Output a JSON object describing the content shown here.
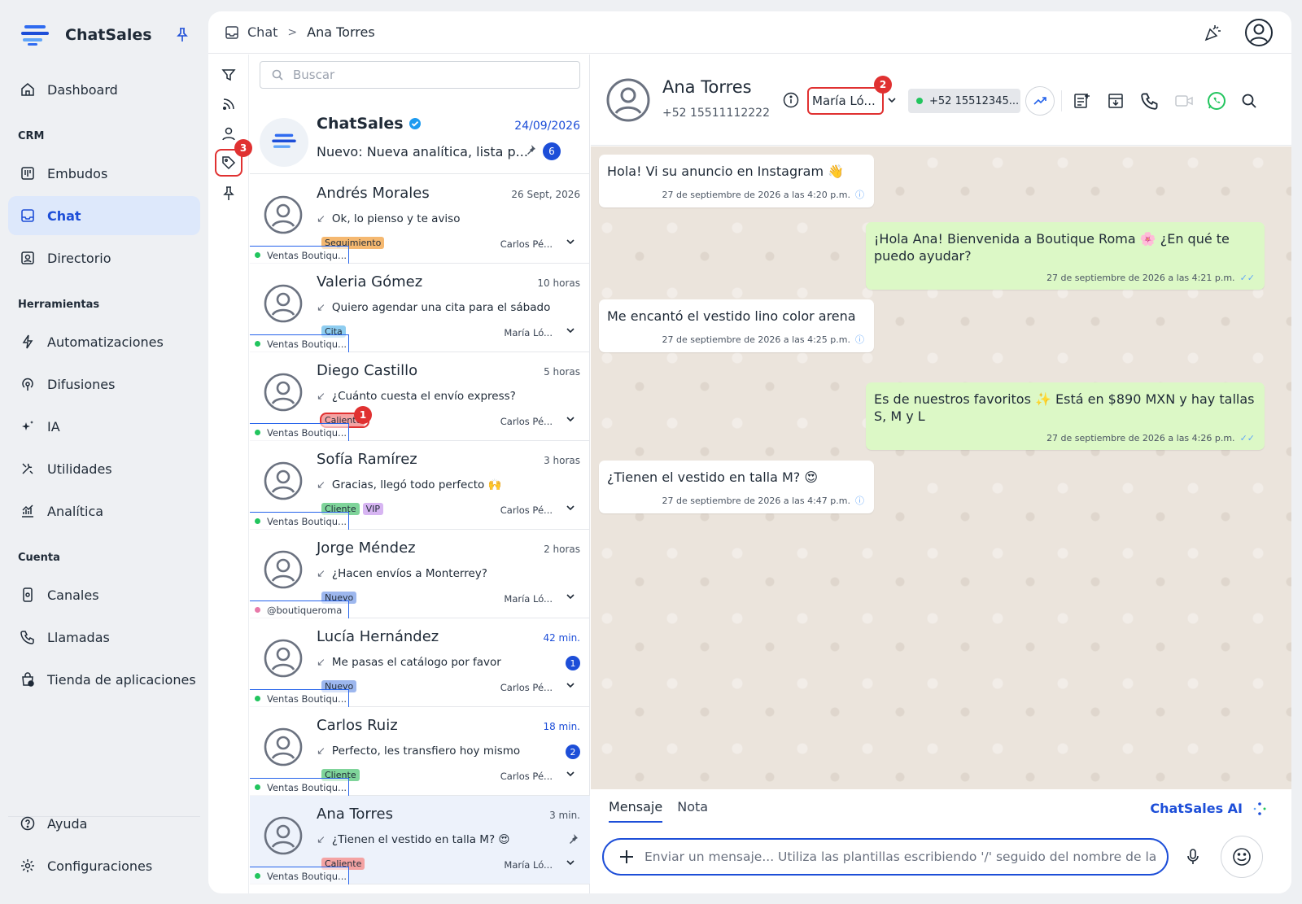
{
  "brand": {
    "name": "ChatSales"
  },
  "nav": {
    "dashboard": "Dashboard",
    "section_crm": "CRM",
    "embudos": "Embudos",
    "chat": "Chat",
    "directorio": "Directorio",
    "section_tools": "Herramientas",
    "automatizaciones": "Automatizaciones",
    "difusiones": "Difusiones",
    "ia": "IA",
    "utilidades": "Utilidades",
    "analitica": "Analítica",
    "section_account": "Cuenta",
    "canales": "Canales",
    "llamadas": "Llamadas",
    "tienda": "Tienda de aplicaciones",
    "ayuda": "Ayuda",
    "configuraciones": "Configuraciones"
  },
  "breadcrumb": {
    "root": "Chat",
    "current": "Ana Torres"
  },
  "filters": {
    "tag_badge": "3"
  },
  "search": {
    "placeholder": "Buscar"
  },
  "pinned": {
    "name": "ChatSales",
    "date": "24/09/2026",
    "preview": "Nuevo: Nueva analítica, lista p...",
    "count": "6"
  },
  "conversations": [
    {
      "name": "Andrés Morales",
      "time": "26 Sept, 2026",
      "preview": "Ok, lo pienso y te aviso",
      "tags": [
        "Seguimiento"
      ],
      "agent": "Carlos Pé...",
      "channel": "Ventas Boutiqu..."
    },
    {
      "name": "Valeria Gómez",
      "time": "10 horas",
      "preview": "Quiero agendar una cita para el sábado",
      "tags": [
        "Cita"
      ],
      "agent": "María Ló...",
      "channel": "Ventas Boutiqu..."
    },
    {
      "name": "Diego Castillo",
      "time": "5 horas",
      "preview": "¿Cuánto cuesta el envío express?",
      "tags": [
        "Caliente"
      ],
      "tag_badge": "1",
      "agent": "Carlos Pé...",
      "channel": "Ventas Boutiqu..."
    },
    {
      "name": "Sofía Ramírez",
      "time": "3 horas",
      "preview": "Gracias, llegó todo perfecto 🙌",
      "tags": [
        "Cliente",
        "VIP"
      ],
      "agent": "Carlos Pé...",
      "channel": "Ventas Boutiqu..."
    },
    {
      "name": "Jorge Méndez",
      "time": "2 horas",
      "preview": "¿Hacen envíos a Monterrey?",
      "tags": [
        "Nuevo"
      ],
      "agent": "María Ló...",
      "channel": "@boutiqueroma"
    },
    {
      "name": "Lucía Hernández",
      "time": "42 min.",
      "preview": "Me pasas el catálogo por favor",
      "tags": [
        "Nuevo"
      ],
      "agent": "Carlos Pé...",
      "channel": "Ventas Boutiqu...",
      "unread": "1"
    },
    {
      "name": "Carlos Ruiz",
      "time": "18 min.",
      "preview": "Perfecto, les transfiero hoy mismo",
      "tags": [
        "Cliente"
      ],
      "agent": "Carlos Pé...",
      "channel": "Ventas Boutiqu...",
      "unread": "2"
    },
    {
      "name": "Ana Torres",
      "time": "3 min.",
      "preview": "¿Tienen el vestido en talla M? 😍",
      "tags": [
        "Caliente"
      ],
      "agent": "María Ló...",
      "channel": "Ventas Boutiqu..."
    }
  ],
  "tag_colors": {
    "Seguimiento": "#f5b870",
    "Cita": "#8ecdf0",
    "Caliente": "#f4a3a3",
    "Cliente": "#7fd49a",
    "VIP": "#d7b5f2",
    "Nuevo": "#9db7ee"
  },
  "chat_header": {
    "name": "Ana Torres",
    "phone": "+52 15511112222",
    "assignee": "María Ló...",
    "assignee_badge": "2",
    "line": "+52 15512345..."
  },
  "messages": [
    {
      "text": "Hola! Vi su anuncio en Instagram 👋",
      "time": "27 de septiembre de 2026 a las 4:20 p.m."
    },
    {
      "text": "¡Hola Ana! Bienvenida a Boutique Roma 🌸 ¿En qué te puedo ayudar?",
      "time": "27 de septiembre de 2026 a las 4:21 p.m."
    },
    {
      "text": "Me encantó el vestido lino color arena",
      "time": "27 de septiembre de 2026 a las 4:25 p.m."
    },
    {
      "text": "Es de nuestros favoritos ✨ Está en $890 MXN y hay tallas S, M y L",
      "time": "27 de septiembre de 2026 a las 4:26 p.m."
    },
    {
      "text": "¿Tienen el vestido en talla M? 😍",
      "time": "27 de septiembre de 2026 a las 4:47 p.m."
    }
  ],
  "composer": {
    "tab_message": "Mensaje",
    "tab_note": "Nota",
    "ai_label": "ChatSales AI",
    "placeholder": "Enviar un mensaje... Utiliza las plantillas escribiendo '/' seguido del nombre de la plantilla"
  },
  "colors": {
    "accent": "#1d4ed8",
    "highlight": "#e03131",
    "whatsapp": "#22c55e",
    "chat_bg": "#ebe4dc",
    "outgoing_bubble": "#dcf8c6"
  }
}
